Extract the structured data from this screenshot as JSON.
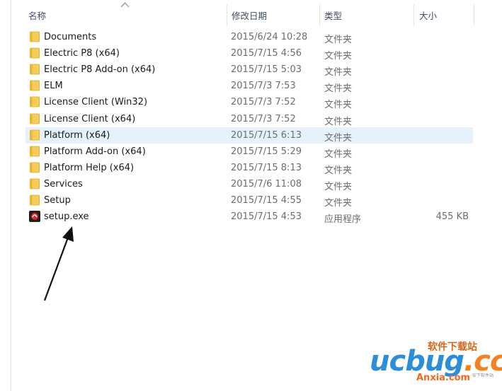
{
  "columns": {
    "name": "名称",
    "date": "修改日期",
    "type": "类型",
    "size": "大小"
  },
  "files": [
    {
      "name": "Documents",
      "date": "2015/6/24 10:28",
      "type": "文件夹",
      "size": "",
      "icon": "folder-icon"
    },
    {
      "name": "Electric P8 (x64)",
      "date": "2015/7/15 4:56",
      "type": "文件夹",
      "size": "",
      "icon": "folder-icon"
    },
    {
      "name": "Electric P8 Add-on (x64)",
      "date": "2015/7/15 5:03",
      "type": "文件夹",
      "size": "",
      "icon": "folder-icon"
    },
    {
      "name": "ELM",
      "date": "2015/7/3 7:53",
      "type": "文件夹",
      "size": "",
      "icon": "folder-icon"
    },
    {
      "name": "License Client (Win32)",
      "date": "2015/7/3 7:52",
      "type": "文件夹",
      "size": "",
      "icon": "folder-icon"
    },
    {
      "name": "License Client (x64)",
      "date": "2015/7/3 7:52",
      "type": "文件夹",
      "size": "",
      "icon": "folder-icon"
    },
    {
      "name": "Platform (x64)",
      "date": "2015/7/15 6:13",
      "type": "文件夹",
      "size": "",
      "icon": "folder-icon",
      "selected": true
    },
    {
      "name": "Platform Add-on (x64)",
      "date": "2015/7/15 5:29",
      "type": "文件夹",
      "size": "",
      "icon": "folder-icon"
    },
    {
      "name": "Platform Help (x64)",
      "date": "2015/7/15 8:13",
      "type": "文件夹",
      "size": "",
      "icon": "folder-icon"
    },
    {
      "name": "Services",
      "date": "2015/7/6 11:08",
      "type": "文件夹",
      "size": "",
      "icon": "folder-icon"
    },
    {
      "name": "Setup",
      "date": "2015/7/15 4:55",
      "type": "文件夹",
      "size": "",
      "icon": "folder-icon"
    },
    {
      "name": "setup.exe",
      "date": "2015/7/15 4:53",
      "type": "应用程序",
      "size": "455 KB",
      "icon": "exe-icon"
    }
  ],
  "watermark": {
    "site_cn": "软件下载站",
    "logo_main": "ucbug",
    "logo_suffix": ".cc",
    "sub": "Anxia.com",
    "sub_cn": "安下软件站"
  },
  "colors": {
    "selected_row": "#e6f1fb",
    "folder": "#f6cd5a",
    "header_text": "#3f4d66"
  }
}
